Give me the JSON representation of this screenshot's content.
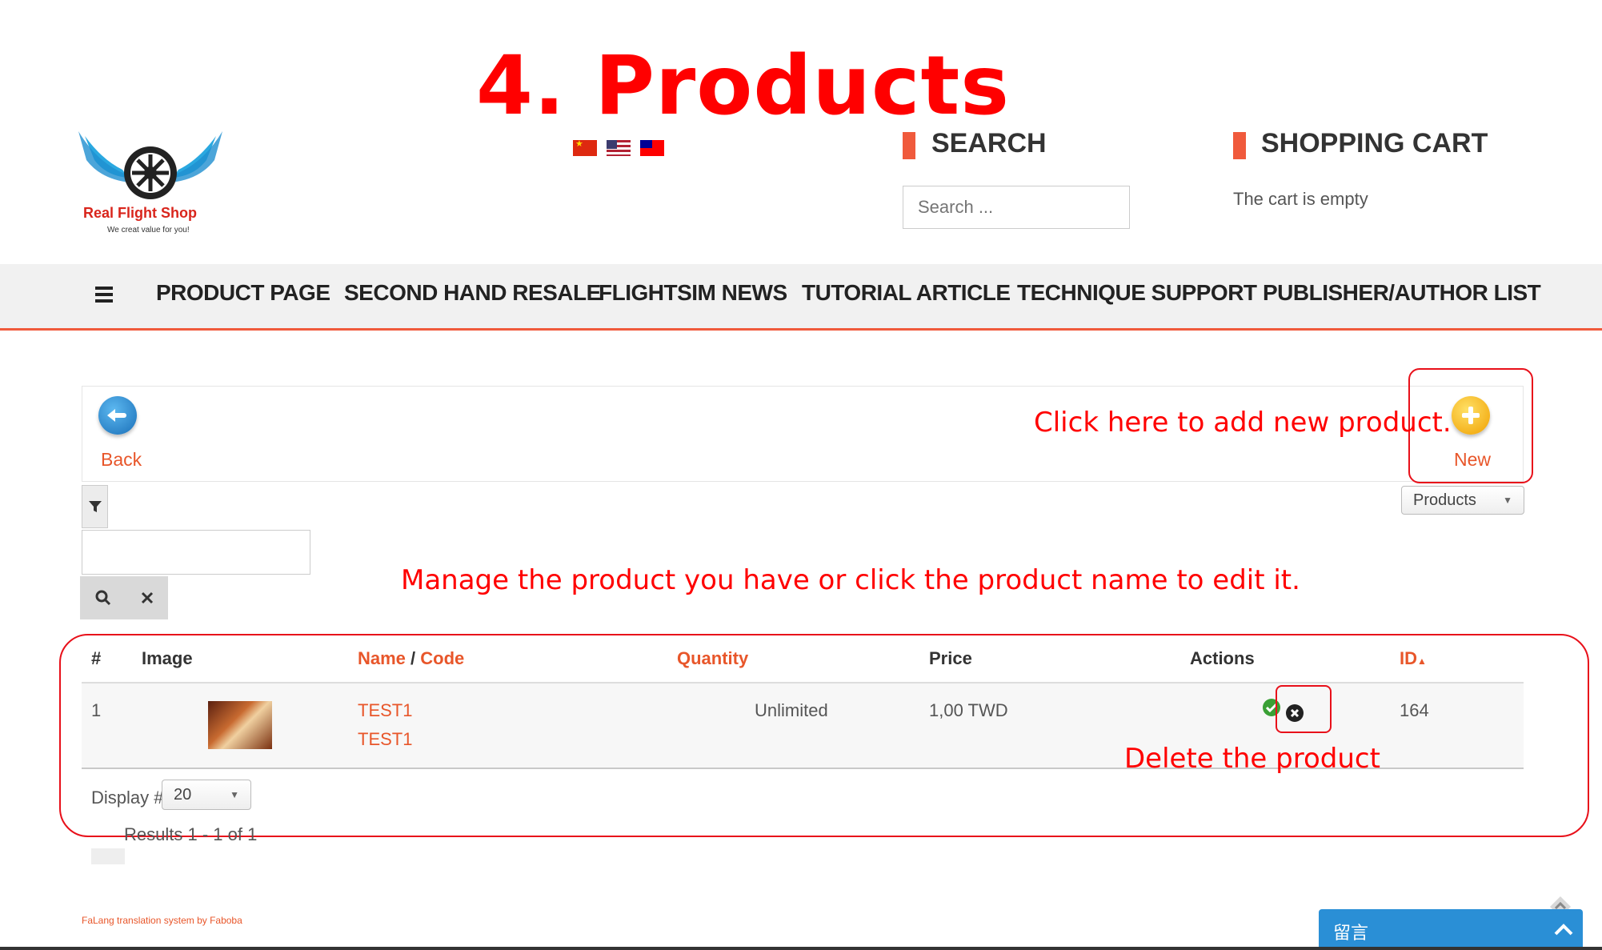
{
  "annotations": {
    "title": "4. Products",
    "add_new": "Click here to add new product.",
    "manage": "Manage the product you have or click the product name to edit it.",
    "delete": "Delete the product"
  },
  "logo": {
    "name": "Real Flight Shop",
    "tagline": "We creat value for you!"
  },
  "languages": [
    "zh-CN flag",
    "en-US flag",
    "zh-TW flag"
  ],
  "search": {
    "heading": "SEARCH",
    "placeholder": "Search ..."
  },
  "cart": {
    "heading": "SHOPPING CART",
    "status": "The cart is empty"
  },
  "nav": {
    "items": [
      "PRODUCT PAGE",
      "SECOND HAND RESALE",
      "FLIGHTSIM NEWS",
      "TUTORIAL ARTICLE",
      "TECHNIQUE SUPPORT",
      "PUBLISHER/AUTHOR LIST"
    ]
  },
  "toolbar": {
    "back_label": "Back",
    "new_label": "New",
    "view_select": "Products"
  },
  "table": {
    "headers": {
      "num": "#",
      "image": "Image",
      "name": "Name",
      "slash": "/",
      "code": "Code",
      "quantity": "Quantity",
      "price": "Price",
      "actions": "Actions",
      "id": "ID"
    },
    "rows": [
      {
        "num": "1",
        "name": "TEST1",
        "code": "TEST1",
        "quantity": "Unlimited",
        "price": "1,00 TWD",
        "id": "164"
      }
    ]
  },
  "pagination": {
    "display_label": "Display #",
    "display_value": "20",
    "results": "Results 1 - 1 of 1"
  },
  "footer": {
    "credit": "FaLang translation system by Faboba"
  },
  "chat": {
    "label": "留言"
  },
  "colors": {
    "annotation": "#ff0000",
    "accent": "#f05a3c",
    "link": "#e8562a",
    "chat": "#2a8fd6"
  }
}
